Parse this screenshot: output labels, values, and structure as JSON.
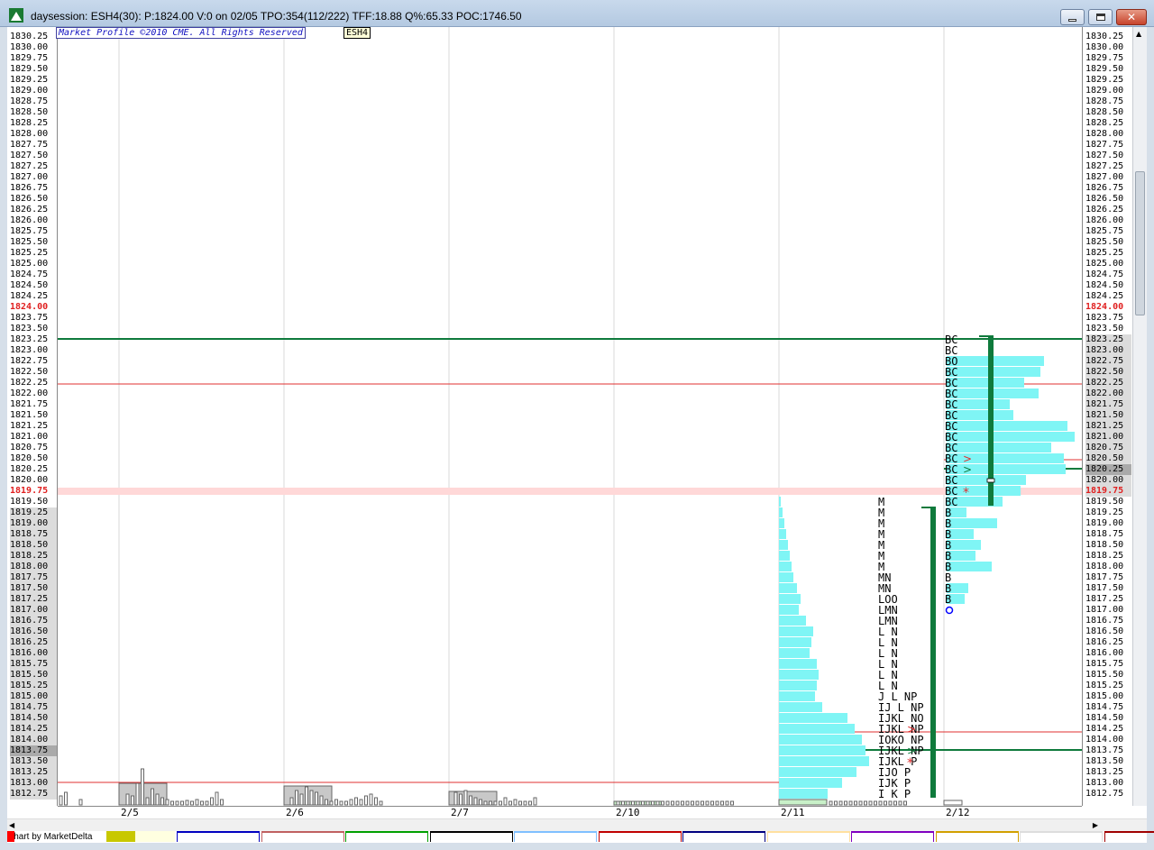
{
  "window": {
    "title": "daysession: ESH4(30): P:1824.00 V:0 on 02/05 TPO:354(112/222) TFF:18.88 Q%:65.33 POC:1746.50"
  },
  "chart": {
    "copyright": "Market Profile ©2010 CME. All Rights Reserved",
    "symbol": "ESH4",
    "credit": "Chart by MarketDelta",
    "price_labels": [
      "1830.25",
      "1830.00",
      "1829.75",
      "1829.50",
      "1829.25",
      "1829.00",
      "1828.75",
      "1828.50",
      "1828.25",
      "1828.00",
      "1827.75",
      "1827.50",
      "1827.25",
      "1827.00",
      "1826.75",
      "1826.50",
      "1826.25",
      "1826.00",
      "1825.75",
      "1825.50",
      "1825.25",
      "1825.00",
      "1824.75",
      "1824.50",
      "1824.25",
      "1824.00",
      "1823.75",
      "1823.50",
      "1823.25",
      "1823.00",
      "1822.75",
      "1822.50",
      "1822.25",
      "1822.00",
      "1821.75",
      "1821.50",
      "1821.25",
      "1821.00",
      "1820.75",
      "1820.50",
      "1820.25",
      "1820.00",
      "1819.75",
      "1819.50",
      "1819.25",
      "1819.00",
      "1818.75",
      "1818.50",
      "1818.25",
      "1818.00",
      "1817.75",
      "1817.50",
      "1817.25",
      "1817.00",
      "1816.75",
      "1816.50",
      "1816.25",
      "1816.00",
      "1815.75",
      "1815.50",
      "1815.25",
      "1815.00",
      "1814.75",
      "1814.50",
      "1814.25",
      "1814.00",
      "1813.75",
      "1813.50",
      "1813.25",
      "1813.00",
      "1812.75"
    ],
    "last_price": "1824.00",
    "highlight_price": "1819.75",
    "dates": [
      "2/5",
      "2/6",
      "2/7",
      "2/10",
      "2/11",
      "2/12"
    ],
    "session_2_11": {
      "tpo_rows": [
        {
          "price": "1819.50",
          "letters": "M"
        },
        {
          "price": "1819.25",
          "letters": "M"
        },
        {
          "price": "1819.00",
          "letters": "M"
        },
        {
          "price": "1818.75",
          "letters": "M"
        },
        {
          "price": "1818.50",
          "letters": "M"
        },
        {
          "price": "1818.25",
          "letters": "M"
        },
        {
          "price": "1818.00",
          "letters": "M"
        },
        {
          "price": "1817.75",
          "letters": "MN"
        },
        {
          "price": "1817.50",
          "letters": "MN"
        },
        {
          "price": "1817.25",
          "letters": "LOO"
        },
        {
          "price": "1817.00",
          "letters": "LMN"
        },
        {
          "price": "1816.75",
          "letters": "LMN"
        },
        {
          "price": "1816.50",
          "letters": "L N"
        },
        {
          "price": "1816.25",
          "letters": "L N"
        },
        {
          "price": "1816.00",
          "letters": "L N"
        },
        {
          "price": "1815.75",
          "letters": "L N"
        },
        {
          "price": "1815.50",
          "letters": "L N"
        },
        {
          "price": "1815.25",
          "letters": "L N"
        },
        {
          "price": "1815.00",
          "letters": " J L NP"
        },
        {
          "price": "1814.75",
          "letters": "IJ L NP"
        },
        {
          "price": "1814.50",
          "letters": "IJKL NO"
        },
        {
          "price": "1814.25",
          "letters": "IJKL NP"
        },
        {
          "price": "1814.00",
          "letters": "IOKO NP"
        },
        {
          "price": "1813.75",
          "letters": "IJKL NP"
        },
        {
          "price": "1813.50",
          "letters": "IJKL  P"
        },
        {
          "price": "1813.25",
          "letters": "IJO   P"
        },
        {
          "price": "1813.00",
          "letters": "IJK   P"
        },
        {
          "price": "1812.75",
          "letters": "I K   P"
        }
      ],
      "volume_widths": [
        2,
        4,
        6,
        8,
        10,
        12,
        14,
        16,
        20,
        24,
        22,
        30,
        38,
        36,
        34,
        42,
        44,
        42,
        40,
        48,
        76,
        84,
        92,
        96,
        100,
        86,
        70,
        54
      ]
    },
    "session_2_12": {
      "tpo_rows": [
        {
          "price": "1823.25",
          "letters": "BC"
        },
        {
          "price": "1823.00",
          "letters": "BC"
        },
        {
          "price": "1822.75",
          "letters": "BO"
        },
        {
          "price": "1822.50",
          "letters": "BC"
        },
        {
          "price": "1822.25",
          "letters": "BC"
        },
        {
          "price": "1822.00",
          "letters": "BC"
        },
        {
          "price": "1821.75",
          "letters": "BC"
        },
        {
          "price": "1821.50",
          "letters": "BC"
        },
        {
          "price": "1821.25",
          "letters": "BC"
        },
        {
          "price": "1821.00",
          "letters": "BC"
        },
        {
          "price": "1820.75",
          "letters": "BC"
        },
        {
          "price": "1820.50",
          "letters": "BC"
        },
        {
          "price": "1820.25",
          "letters": "BC"
        },
        {
          "price": "1820.00",
          "letters": "BC"
        },
        {
          "price": "1819.75",
          "letters": "BC"
        },
        {
          "price": "1819.50",
          "letters": "BC"
        },
        {
          "price": "1819.25",
          "letters": "B"
        },
        {
          "price": "1819.00",
          "letters": "B"
        },
        {
          "price": "1818.75",
          "letters": "B"
        },
        {
          "price": "1818.50",
          "letters": "B"
        },
        {
          "price": "1818.25",
          "letters": "B"
        },
        {
          "price": "1818.00",
          "letters": "B"
        },
        {
          "price": "1817.75",
          "letters": "B"
        },
        {
          "price": "1817.50",
          "letters": "B"
        },
        {
          "price": "1817.25",
          "letters": "B"
        }
      ],
      "volume_widths": [
        0,
        0,
        108,
        104,
        86,
        102,
        70,
        74,
        134,
        142,
        116,
        130,
        132,
        88,
        82,
        62,
        22,
        56,
        30,
        38,
        32,
        50,
        0,
        24,
        20
      ]
    },
    "colors": {
      "profile": "#7ff5f5",
      "value_area": "#0f7a3c",
      "poc_red": "#e03030",
      "grid": "#d8d8d8",
      "volume_bar": "#c8c8c8"
    },
    "legend_colors": [
      "#ff0000",
      "#c8c800",
      "#ffffe0",
      "#0000c0",
      "#c06060",
      "#00a000",
      "#000000",
      "#80c0ff",
      "#c00000",
      "#000080",
      "#ffe0a0",
      "#8000c0",
      "#d2a000",
      "#dddddd",
      "#a00000"
    ]
  }
}
